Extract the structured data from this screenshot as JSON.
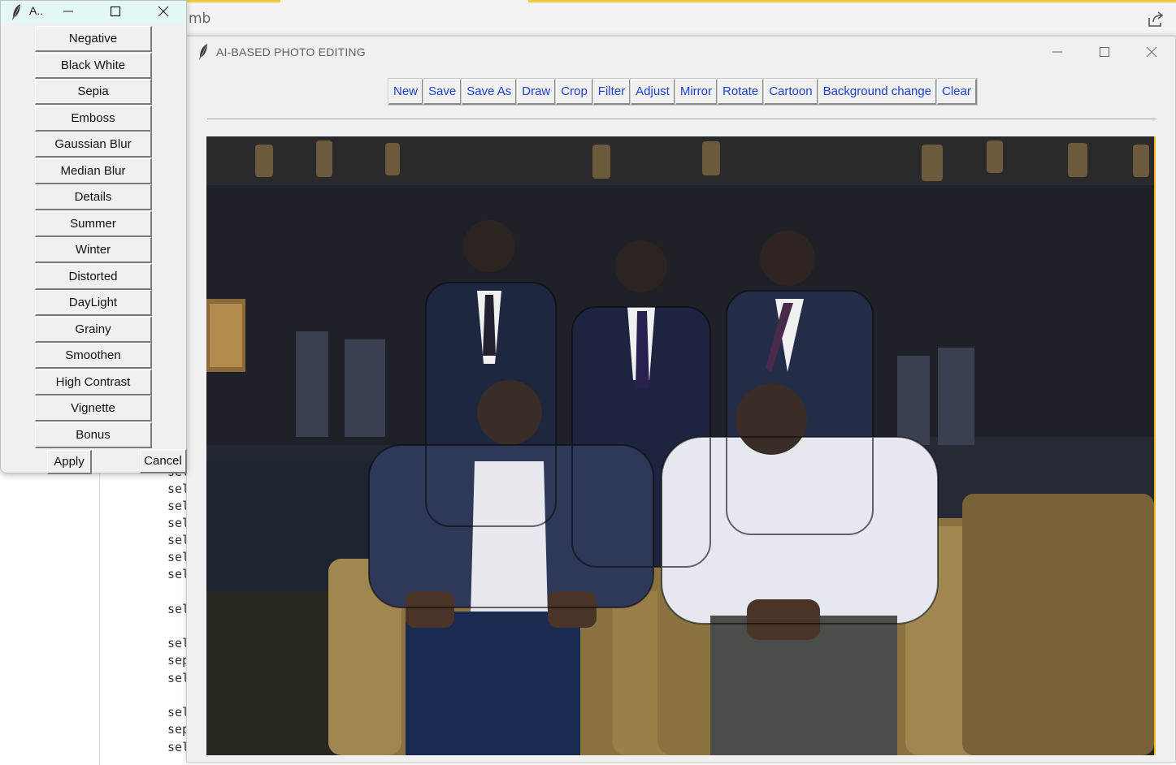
{
  "background": {
    "tab_text": "mb",
    "code_lines": [
      "sel",
      "sel",
      "sel",
      "sel",
      "sel",
      "sel",
      "sel",
      "sel",
      "sel",
      "sep",
      "sel",
      "sel",
      "sep",
      "sel"
    ]
  },
  "main_window": {
    "title": "AI-BASED PHOTO EDITING",
    "toolbar": [
      "New",
      "Save",
      "Save As",
      "Draw",
      "Crop",
      "Filter",
      "Adjust",
      "Mirror",
      "Rotate",
      "Cartoon",
      "Background change",
      "Clear"
    ],
    "toolbar_color": "#1f3fd6",
    "image_description_icon": "cartoon-photo"
  },
  "filter_dialog": {
    "title": "A..",
    "filters": [
      "Negative",
      "Black White",
      "Sepia",
      "Emboss",
      "Gaussian Blur",
      "Median Blur",
      "Details",
      "Summer",
      "Winter",
      "Distorted",
      "DayLight",
      "Grainy",
      "Smoothen",
      "High Contrast",
      "Vignette",
      "Bonus"
    ],
    "apply_label": "Apply",
    "cancel_label": "Cancel"
  }
}
